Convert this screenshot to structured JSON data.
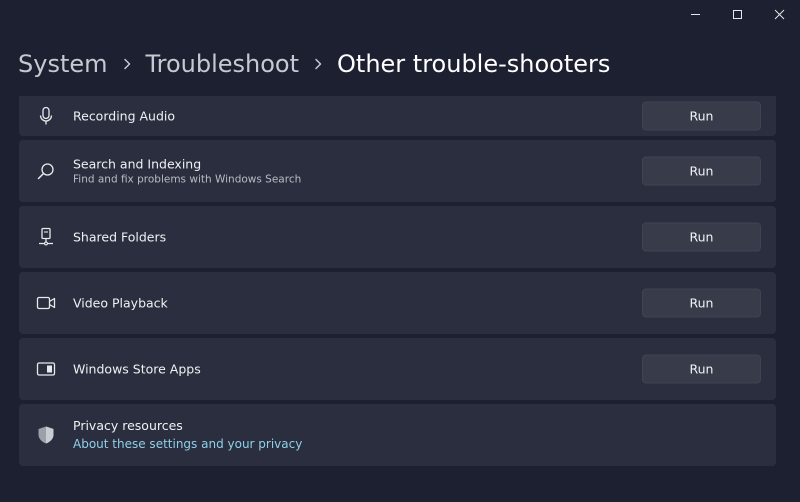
{
  "window_controls": [
    "minimize",
    "maximize",
    "close"
  ],
  "breadcrumb": {
    "items": [
      "System",
      "Troubleshoot",
      "Other trouble-shooters"
    ]
  },
  "troubleshooters": [
    {
      "title": "Recording Audio",
      "subtitle": "",
      "icon": "microphone-icon",
      "button": "Run"
    },
    {
      "title": "Search and Indexing",
      "subtitle": "Find and fix problems with Windows Search",
      "icon": "search-icon",
      "button": "Run"
    },
    {
      "title": "Shared Folders",
      "subtitle": "",
      "icon": "shared-folder-icon",
      "button": "Run"
    },
    {
      "title": "Video Playback",
      "subtitle": "",
      "icon": "video-camera-icon",
      "button": "Run"
    },
    {
      "title": "Windows Store Apps",
      "subtitle": "",
      "icon": "app-window-icon",
      "button": "Run"
    }
  ],
  "privacy": {
    "title": "Privacy resources",
    "link": "About these settings and your privacy",
    "icon": "shield-icon"
  },
  "colors": {
    "background": "#1c2030",
    "card": "#2a2e3e",
    "button": "#373b4a",
    "link": "#8fd0ea"
  }
}
